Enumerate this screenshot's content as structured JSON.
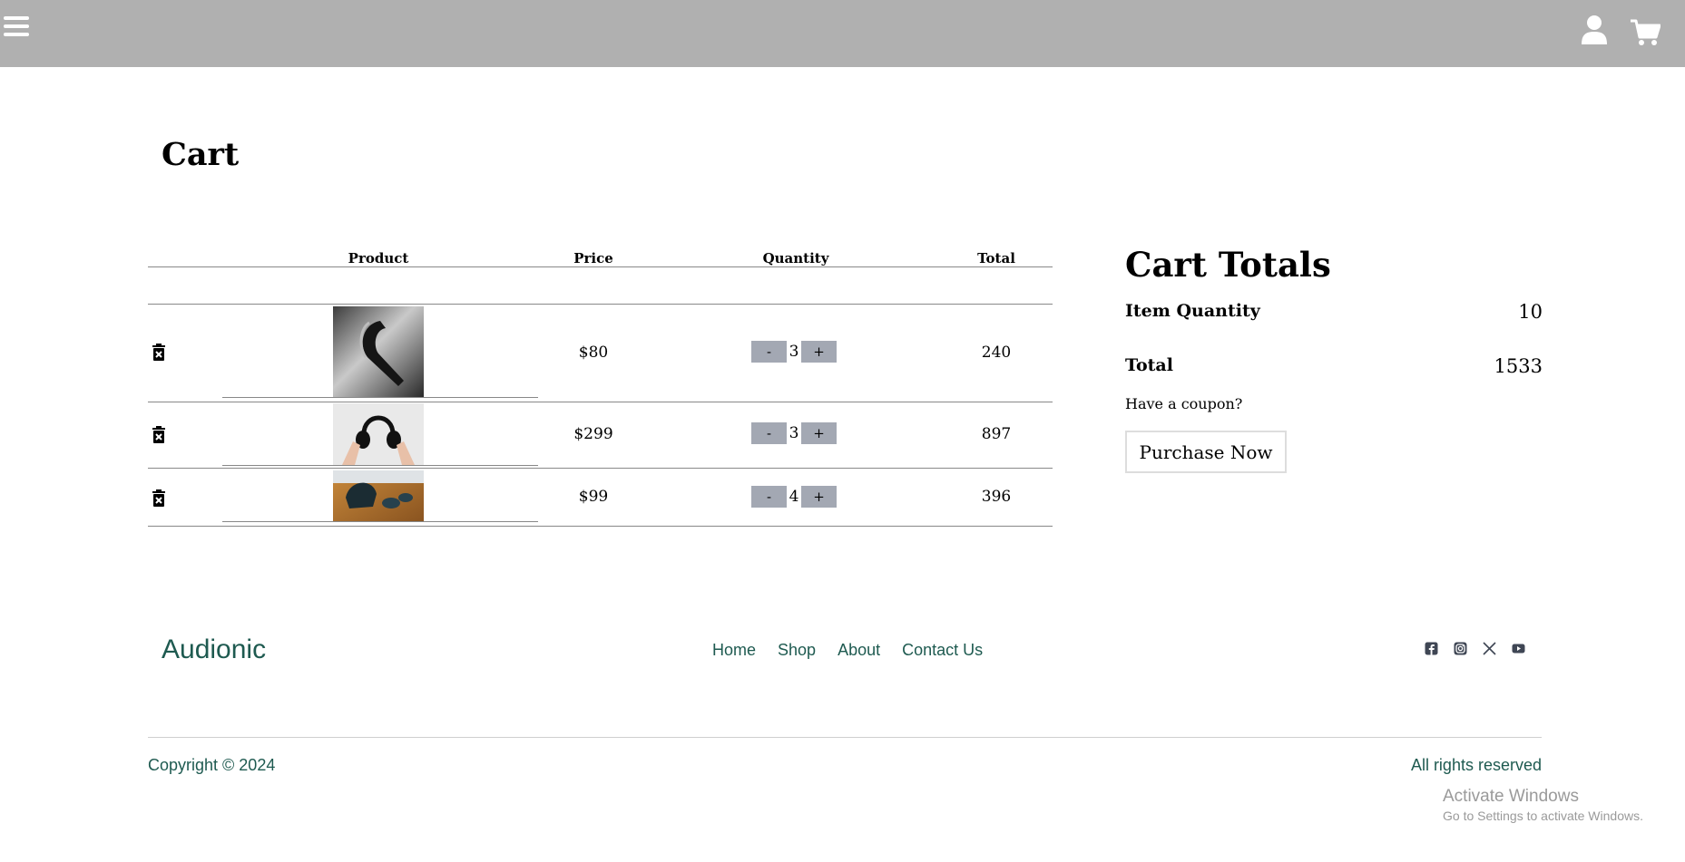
{
  "header": {
    "menu_icon": "hamburger-icon",
    "user_icon": "user-icon",
    "cart_icon": "shopping-cart-icon"
  },
  "page_title": "Cart",
  "table": {
    "columns": [
      "Product",
      "Price",
      "Quantity",
      "Total"
    ],
    "rows": [
      {
        "price": "$80",
        "qty_minus": "-",
        "quantity": "3",
        "qty_plus": "+",
        "total": "240",
        "image": "single-ear-bluetooth-headset-photo"
      },
      {
        "price": "$299",
        "qty_minus": "-",
        "quantity": "3",
        "qty_plus": "+",
        "total": "897",
        "image": "over-ear-headphones-photo"
      },
      {
        "price": "$99",
        "qty_minus": "-",
        "quantity": "4",
        "qty_plus": "+",
        "total": "396",
        "image": "earbuds-case-photo"
      }
    ]
  },
  "totals": {
    "title": "Cart Totals",
    "item_quantity_label": "Item Quantity",
    "item_quantity_value": "10",
    "total_label": "Total",
    "total_value": "1533",
    "coupon_text": "Have a coupon?",
    "purchase_label": "Purchase Now"
  },
  "footer": {
    "brand": "Audionic",
    "nav": [
      "Home",
      "Shop",
      "About",
      "Contact Us"
    ],
    "social": [
      "facebook-icon",
      "instagram-icon",
      "x-twitter-icon",
      "youtube-icon"
    ],
    "copyright": "Copyright © 2024",
    "rights": "All rights reserved"
  },
  "watermark": {
    "title": "Activate Windows",
    "subtitle": "Go to Settings to activate Windows."
  },
  "colors": {
    "topbar": "#b0b0b0",
    "footer_text": "#1e5a50",
    "qty_button": "#a3a8b3"
  }
}
